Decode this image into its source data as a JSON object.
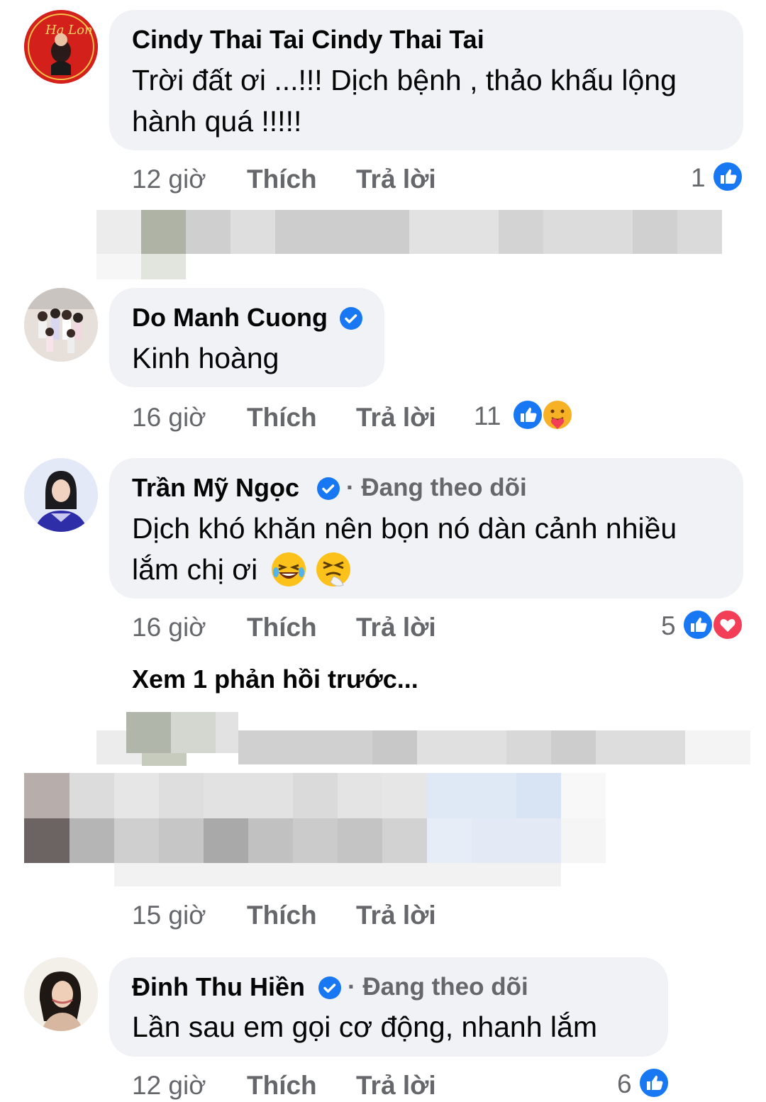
{
  "comments": [
    {
      "author": "Cindy Thai Tai Cindy Thai Tai",
      "text": "Trời đất ơi ...!!! Dịch bệnh , thảo khấu lộng hành quá !!!!!",
      "time": "12 giờ",
      "like_label": "Thích",
      "reply_label": "Trả lời",
      "reaction_count": "1"
    },
    {
      "author": "Do Manh Cuong",
      "text": "Kinh hoàng",
      "time": "16 giờ",
      "like_label": "Thích",
      "reply_label": "Trả lời",
      "reaction_count": "11"
    },
    {
      "author": "Trần Mỹ Ngọc",
      "follow": "· Đang theo dõi",
      "text": "Dịch khó khăn nên bọn nó dàn cảnh nhiều lắm chị ơi",
      "time": "16 giờ",
      "like_label": "Thích",
      "reply_label": "Trả lời",
      "reaction_count": "5"
    },
    {
      "time": "15 giờ",
      "like_label": "Thích",
      "reply_label": "Trả lời"
    },
    {
      "author": "Đinh Thu Hiền",
      "follow": "· Đang theo dõi",
      "text": "Lần sau em gọi cơ động, nhanh lắm",
      "time": "12 giờ",
      "like_label": "Thích",
      "reply_label": "Trả lời",
      "reaction_count": "6"
    }
  ],
  "view_previous_replies": "Xem 1 phản hồi trước...",
  "colors": {
    "bubble": "#f0f2f5",
    "meta_text": "#65676b",
    "like_blue": "#1877f2",
    "love_red": "#f33e58",
    "verified": "#1877f2"
  },
  "icons": [
    "like-reaction-icon",
    "love-reaction-icon",
    "care-reaction-icon",
    "verified-badge-icon",
    "laughing-emoji-icon",
    "sneezing-emoji-icon"
  ]
}
